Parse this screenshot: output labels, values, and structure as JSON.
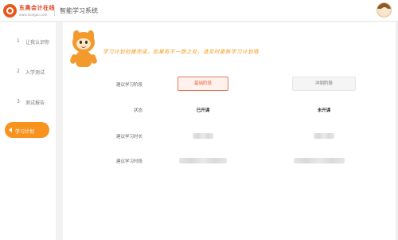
{
  "header": {
    "logo_name": "东奥会计在线",
    "logo_url": "www.dongao.com",
    "title": "智能学习系统"
  },
  "sidebar": {
    "items": [
      {
        "num": "1",
        "label": "让我认识你"
      },
      {
        "num": "2",
        "label": "入学测试"
      },
      {
        "num": "3",
        "label": "测试报告"
      },
      {
        "num": "4",
        "label": "学习计划"
      }
    ]
  },
  "main": {
    "tip": "学习计划创建完成，如果有不一致之处，请及时更新学习计划哦",
    "rows": {
      "stage_label": "建议学习阶段",
      "status_label": "状态",
      "duration_label": "建议学习时长",
      "period_label": "建议学习时段"
    },
    "stages": {
      "basic": "基础阶段",
      "sprint": "冲刺阶段"
    },
    "status": {
      "basic": "已开课",
      "sprint": "未开课"
    }
  },
  "colors": {
    "accent": "#f7931e",
    "basic_border": "#e8785a",
    "tip_text": "#f29b1a"
  }
}
